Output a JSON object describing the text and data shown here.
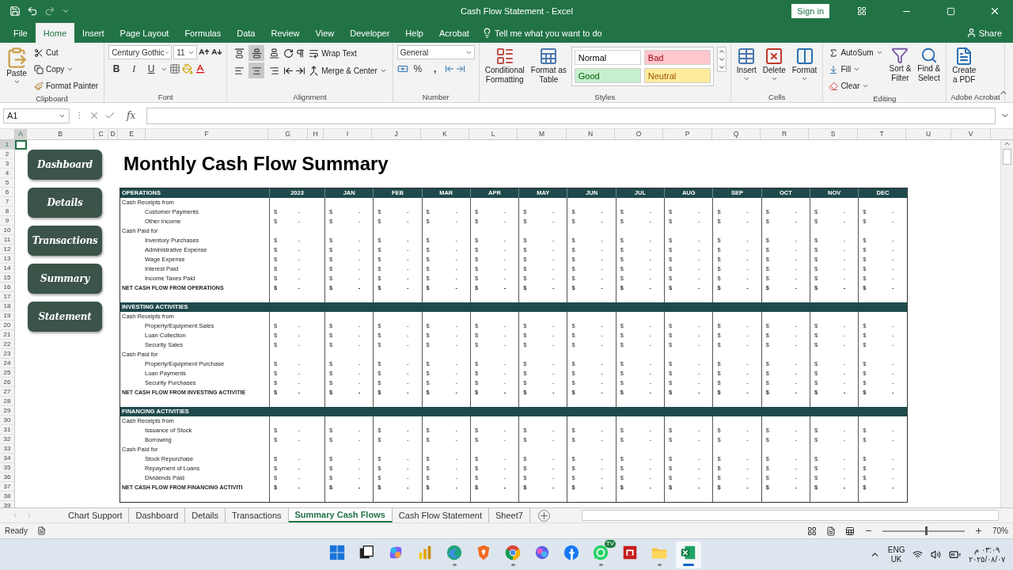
{
  "window": {
    "title": "Cash Flow Statement  -  Excel",
    "sign_in": "Sign in"
  },
  "ribbon_tabs": [
    {
      "label": "File",
      "selected": false
    },
    {
      "label": "Home",
      "selected": true
    },
    {
      "label": "Insert",
      "selected": false
    },
    {
      "label": "Page Layout",
      "selected": false
    },
    {
      "label": "Formulas",
      "selected": false
    },
    {
      "label": "Data",
      "selected": false
    },
    {
      "label": "Review",
      "selected": false
    },
    {
      "label": "View",
      "selected": false
    },
    {
      "label": "Developer",
      "selected": false
    },
    {
      "label": "Help",
      "selected": false
    },
    {
      "label": "Acrobat",
      "selected": false
    }
  ],
  "tell_me": "Tell me what you want to do",
  "share": "Share",
  "ribbon": {
    "clipboard": {
      "paste": "Paste",
      "cut": "Cut",
      "copy": "Copy",
      "format_painter": "Format Painter",
      "label": "Clipboard"
    },
    "font": {
      "name": "Century Gothic",
      "size": "11",
      "bold": "B",
      "italic": "I",
      "underline": "U",
      "label": "Font"
    },
    "alignment": {
      "vertical": [
        {
          "kind": "top",
          "selected": false
        },
        {
          "kind": "middle",
          "selected": true
        },
        {
          "kind": "bottom",
          "selected": false
        }
      ],
      "horizontal": [
        {
          "kind": "left",
          "selected": false
        },
        {
          "kind": "center",
          "selected": true
        },
        {
          "kind": "right",
          "selected": false
        }
      ],
      "wrap_text": "Wrap Text",
      "merge_center": "Merge & Center",
      "label": "Alignment"
    },
    "number": {
      "format": "General",
      "percent": "%",
      "comma": ",",
      "label": "Number"
    },
    "styles": {
      "conditional_formatting": [
        "Conditional",
        "Formatting"
      ],
      "format_as_table": [
        "Format as",
        "Table"
      ],
      "cell_styles": [
        {
          "label": "Normal",
          "kind": "normal",
          "color": "#ffffff"
        },
        {
          "label": "Bad",
          "kind": "bad",
          "color": "#ffc7ce"
        },
        {
          "label": "Good",
          "kind": "good",
          "color": "#c6efce"
        },
        {
          "label": "Neutral",
          "kind": "neutral",
          "color": "#ffeb9c"
        }
      ],
      "label": "Styles"
    },
    "cells": {
      "insert": "Insert",
      "delete": "Delete",
      "format": "Format",
      "label": "Cells"
    },
    "editing": {
      "autosum": "AutoSum",
      "fill": "Fill",
      "clear": "Clear",
      "sort_filter": [
        "Sort &",
        "Filter"
      ],
      "find_select": [
        "Find &",
        "Select"
      ],
      "label": "Editing"
    },
    "acrobat": {
      "create_pdf": [
        "Create",
        "a PDF"
      ],
      "label": "Adobe Acrobat"
    }
  },
  "formula_bar": {
    "name_box": "A1",
    "function_label": "fx"
  },
  "sheet": {
    "columns": [
      {
        "label": "A",
        "selected": true
      },
      {
        "label": "B",
        "selected": false
      },
      {
        "label": "C",
        "selected": false
      },
      {
        "label": "D",
        "selected": false
      },
      {
        "label": "E",
        "selected": false
      },
      {
        "label": "F",
        "selected": false
      },
      {
        "label": "G",
        "selected": false
      },
      {
        "label": "H",
        "selected": false
      },
      {
        "label": "I",
        "selected": false
      },
      {
        "label": "J",
        "selected": false
      },
      {
        "label": "K",
        "selected": false
      },
      {
        "label": "L",
        "selected": false
      },
      {
        "label": "M",
        "selected": false
      },
      {
        "label": "N",
        "selected": false
      },
      {
        "label": "O",
        "selected": false
      },
      {
        "label": "P",
        "selected": false
      },
      {
        "label": "Q",
        "selected": false
      },
      {
        "label": "R",
        "selected": false
      },
      {
        "label": "S",
        "selected": false
      },
      {
        "label": "T",
        "selected": false
      },
      {
        "label": "U",
        "selected": false
      },
      {
        "label": "V",
        "selected": false
      }
    ],
    "rows": [
      {
        "label": "1",
        "selected": true
      },
      {
        "label": "2",
        "selected": false
      },
      {
        "label": "3",
        "selected": false
      },
      {
        "label": "4",
        "selected": false
      },
      {
        "label": "5",
        "selected": false
      },
      {
        "label": "6",
        "selected": false
      },
      {
        "label": "7",
        "selected": false
      },
      {
        "label": "8",
        "selected": false
      },
      {
        "label": "9",
        "selected": false
      },
      {
        "label": "10",
        "selected": false
      },
      {
        "label": "11",
        "selected": false
      },
      {
        "label": "12",
        "selected": false
      },
      {
        "label": "13",
        "selected": false
      },
      {
        "label": "14",
        "selected": false
      },
      {
        "label": "15",
        "selected": false
      },
      {
        "label": "16",
        "selected": false
      },
      {
        "label": "17",
        "selected": false
      },
      {
        "label": "18",
        "selected": false
      },
      {
        "label": "19",
        "selected": false
      },
      {
        "label": "20",
        "selected": false
      },
      {
        "label": "21",
        "selected": false
      },
      {
        "label": "22",
        "selected": false
      },
      {
        "label": "23",
        "selected": false
      },
      {
        "label": "24",
        "selected": false
      },
      {
        "label": "25",
        "selected": false
      },
      {
        "label": "26",
        "selected": false
      },
      {
        "label": "27",
        "selected": false
      },
      {
        "label": "28",
        "selected": false
      },
      {
        "label": "29",
        "selected": false
      },
      {
        "label": "30",
        "selected": false
      },
      {
        "label": "31",
        "selected": false
      },
      {
        "label": "32",
        "selected": false
      },
      {
        "label": "33",
        "selected": false
      },
      {
        "label": "34",
        "selected": false
      },
      {
        "label": "35",
        "selected": false
      },
      {
        "label": "36",
        "selected": false
      },
      {
        "label": "37",
        "selected": false
      },
      {
        "label": "38",
        "selected": false
      },
      {
        "label": "39",
        "selected": false
      }
    ],
    "nav_buttons": [
      "Dashboard",
      "Details",
      "Transactions",
      "Summary",
      "Statement"
    ],
    "title": "Monthly Cash Flow Summary",
    "sections": [
      {
        "heading": "OPERATIONS",
        "column_labels": [
          "2023",
          "JAN",
          "FEB",
          "MAR",
          "APR",
          "MAY",
          "JUN",
          "JUL",
          "AUG",
          "SEP",
          "OCT",
          "NOV",
          "DEC"
        ],
        "rows": [
          {
            "kind": "group",
            "label": "Cash Receipts from"
          },
          {
            "kind": "item",
            "label": "Customer Payments",
            "cells": [
              [
                "$",
                "-"
              ],
              [
                "$",
                "-"
              ],
              [
                "$",
                "-"
              ],
              [
                "$",
                "-"
              ],
              [
                "$",
                "-"
              ],
              [
                "$",
                "-"
              ],
              [
                "$",
                "-"
              ],
              [
                "$",
                "-"
              ],
              [
                "$",
                "-"
              ],
              [
                "$",
                "-"
              ],
              [
                "$",
                "-"
              ],
              [
                "$",
                "-"
              ],
              [
                "$",
                "-"
              ]
            ]
          },
          {
            "kind": "item",
            "label": "Other Income",
            "cells": [
              [
                "$",
                "-"
              ],
              [
                "$",
                "-"
              ],
              [
                "$",
                "-"
              ],
              [
                "$",
                "-"
              ],
              [
                "$",
                "-"
              ],
              [
                "$",
                "-"
              ],
              [
                "$",
                "-"
              ],
              [
                "$",
                "-"
              ],
              [
                "$",
                "-"
              ],
              [
                "$",
                "-"
              ],
              [
                "$",
                "-"
              ],
              [
                "$",
                "-"
              ],
              [
                "$",
                "-"
              ]
            ]
          },
          {
            "kind": "group",
            "label": "Cash Paid for"
          },
          {
            "kind": "item",
            "label": "Inventory Purchases",
            "cells": [
              [
                "$",
                "-"
              ],
              [
                "$",
                "-"
              ],
              [
                "$",
                "-"
              ],
              [
                "$",
                "-"
              ],
              [
                "$",
                "-"
              ],
              [
                "$",
                "-"
              ],
              [
                "$",
                "-"
              ],
              [
                "$",
                "-"
              ],
              [
                "$",
                "-"
              ],
              [
                "$",
                "-"
              ],
              [
                "$",
                "-"
              ],
              [
                "$",
                "-"
              ],
              [
                "$",
                "-"
              ]
            ]
          },
          {
            "kind": "item",
            "label": "Administrative Expense",
            "cells": [
              [
                "$",
                "-"
              ],
              [
                "$",
                "-"
              ],
              [
                "$",
                "-"
              ],
              [
                "$",
                "-"
              ],
              [
                "$",
                "-"
              ],
              [
                "$",
                "-"
              ],
              [
                "$",
                "-"
              ],
              [
                "$",
                "-"
              ],
              [
                "$",
                "-"
              ],
              [
                "$",
                "-"
              ],
              [
                "$",
                "-"
              ],
              [
                "$",
                "-"
              ],
              [
                "$",
                "-"
              ]
            ]
          },
          {
            "kind": "item",
            "label": "Wage Expense",
            "cells": [
              [
                "$",
                "-"
              ],
              [
                "$",
                "-"
              ],
              [
                "$",
                "-"
              ],
              [
                "$",
                "-"
              ],
              [
                "$",
                "-"
              ],
              [
                "$",
                "-"
              ],
              [
                "$",
                "-"
              ],
              [
                "$",
                "-"
              ],
              [
                "$",
                "-"
              ],
              [
                "$",
                "-"
              ],
              [
                "$",
                "-"
              ],
              [
                "$",
                "-"
              ],
              [
                "$",
                "-"
              ]
            ]
          },
          {
            "kind": "item",
            "label": "Interest Paid",
            "cells": [
              [
                "$",
                "-"
              ],
              [
                "$",
                "-"
              ],
              [
                "$",
                "-"
              ],
              [
                "$",
                "-"
              ],
              [
                "$",
                "-"
              ],
              [
                "$",
                "-"
              ],
              [
                "$",
                "-"
              ],
              [
                "$",
                "-"
              ],
              [
                "$",
                "-"
              ],
              [
                "$",
                "-"
              ],
              [
                "$",
                "-"
              ],
              [
                "$",
                "-"
              ],
              [
                "$",
                "-"
              ]
            ]
          },
          {
            "kind": "item",
            "label": "Income Taxes Paid",
            "cells": [
              [
                "$",
                "-"
              ],
              [
                "$",
                "-"
              ],
              [
                "$",
                "-"
              ],
              [
                "$",
                "-"
              ],
              [
                "$",
                "-"
              ],
              [
                "$",
                "-"
              ],
              [
                "$",
                "-"
              ],
              [
                "$",
                "-"
              ],
              [
                "$",
                "-"
              ],
              [
                "$",
                "-"
              ],
              [
                "$",
                "-"
              ],
              [
                "$",
                "-"
              ],
              [
                "$",
                "-"
              ]
            ]
          },
          {
            "kind": "total",
            "label": "NET CASH FLOW FROM OPERATIONS",
            "cells": [
              [
                "$",
                "-"
              ],
              [
                "$",
                "-"
              ],
              [
                "$",
                "-"
              ],
              [
                "$",
                "-"
              ],
              [
                "$",
                "-"
              ],
              [
                "$",
                "-"
              ],
              [
                "$",
                "-"
              ],
              [
                "$",
                "-"
              ],
              [
                "$",
                "-"
              ],
              [
                "$",
                "-"
              ],
              [
                "$",
                "-"
              ],
              [
                "$",
                "-"
              ],
              [
                "$",
                "-"
              ]
            ]
          }
        ]
      },
      {
        "heading": "INVESTING ACTIVITIES",
        "rows": [
          {
            "kind": "group",
            "label": "Cash Receipts from"
          },
          {
            "kind": "item",
            "label": "Property/Equipment Sales",
            "cells": [
              [
                "$",
                "-"
              ],
              [
                "$",
                "-"
              ],
              [
                "$",
                "-"
              ],
              [
                "$",
                "-"
              ],
              [
                "$",
                "-"
              ],
              [
                "$",
                "-"
              ],
              [
                "$",
                "-"
              ],
              [
                "$",
                "-"
              ],
              [
                "$",
                "-"
              ],
              [
                "$",
                "-"
              ],
              [
                "$",
                "-"
              ],
              [
                "$",
                "-"
              ],
              [
                "$",
                "-"
              ]
            ]
          },
          {
            "kind": "item",
            "label": "Loan Collection",
            "cells": [
              [
                "$",
                "-"
              ],
              [
                "$",
                "-"
              ],
              [
                "$",
                "-"
              ],
              [
                "$",
                "-"
              ],
              [
                "$",
                "-"
              ],
              [
                "$",
                "-"
              ],
              [
                "$",
                "-"
              ],
              [
                "$",
                "-"
              ],
              [
                "$",
                "-"
              ],
              [
                "$",
                "-"
              ],
              [
                "$",
                "-"
              ],
              [
                "$",
                "-"
              ],
              [
                "$",
                "-"
              ]
            ]
          },
          {
            "kind": "item",
            "label": "Security Sales",
            "cells": [
              [
                "$",
                "-"
              ],
              [
                "$",
                "-"
              ],
              [
                "$",
                "-"
              ],
              [
                "$",
                "-"
              ],
              [
                "$",
                "-"
              ],
              [
                "$",
                "-"
              ],
              [
                "$",
                "-"
              ],
              [
                "$",
                "-"
              ],
              [
                "$",
                "-"
              ],
              [
                "$",
                "-"
              ],
              [
                "$",
                "-"
              ],
              [
                "$",
                "-"
              ],
              [
                "$",
                "-"
              ]
            ]
          },
          {
            "kind": "group",
            "label": "Cash Paid for"
          },
          {
            "kind": "item",
            "label": "Property/Equipment Purchase",
            "cells": [
              [
                "$",
                "-"
              ],
              [
                "$",
                "-"
              ],
              [
                "$",
                "-"
              ],
              [
                "$",
                "-"
              ],
              [
                "$",
                "-"
              ],
              [
                "$",
                "-"
              ],
              [
                "$",
                "-"
              ],
              [
                "$",
                "-"
              ],
              [
                "$",
                "-"
              ],
              [
                "$",
                "-"
              ],
              [
                "$",
                "-"
              ],
              [
                "$",
                "-"
              ],
              [
                "$",
                "-"
              ]
            ]
          },
          {
            "kind": "item",
            "label": "Loan Payments",
            "cells": [
              [
                "$",
                "-"
              ],
              [
                "$",
                "-"
              ],
              [
                "$",
                "-"
              ],
              [
                "$",
                "-"
              ],
              [
                "$",
                "-"
              ],
              [
                "$",
                "-"
              ],
              [
                "$",
                "-"
              ],
              [
                "$",
                "-"
              ],
              [
                "$",
                "-"
              ],
              [
                "$",
                "-"
              ],
              [
                "$",
                "-"
              ],
              [
                "$",
                "-"
              ],
              [
                "$",
                "-"
              ]
            ]
          },
          {
            "kind": "item",
            "label": "Security Purchases",
            "cells": [
              [
                "$",
                "-"
              ],
              [
                "$",
                "-"
              ],
              [
                "$",
                "-"
              ],
              [
                "$",
                "-"
              ],
              [
                "$",
                "-"
              ],
              [
                "$",
                "-"
              ],
              [
                "$",
                "-"
              ],
              [
                "$",
                "-"
              ],
              [
                "$",
                "-"
              ],
              [
                "$",
                "-"
              ],
              [
                "$",
                "-"
              ],
              [
                "$",
                "-"
              ],
              [
                "$",
                "-"
              ]
            ]
          },
          {
            "kind": "total",
            "label": "NET CASH FLOW FROM INVESTING ACTIVITIE",
            "cells": [
              [
                "$",
                "-"
              ],
              [
                "$",
                "-"
              ],
              [
                "$",
                "-"
              ],
              [
                "$",
                "-"
              ],
              [
                "$",
                "-"
              ],
              [
                "$",
                "-"
              ],
              [
                "$",
                "-"
              ],
              [
                "$",
                "-"
              ],
              [
                "$",
                "-"
              ],
              [
                "$",
                "-"
              ],
              [
                "$",
                "-"
              ],
              [
                "$",
                "-"
              ],
              [
                "$",
                "-"
              ]
            ]
          }
        ]
      },
      {
        "heading": "FINANCING ACTIVITIES",
        "rows": [
          {
            "kind": "group",
            "label": "Cash Receipts from"
          },
          {
            "kind": "item",
            "label": "Issuance of Stock",
            "cells": [
              [
                "$",
                "-"
              ],
              [
                "$",
                "-"
              ],
              [
                "$",
                "-"
              ],
              [
                "$",
                "-"
              ],
              [
                "$",
                "-"
              ],
              [
                "$",
                "-"
              ],
              [
                "$",
                "-"
              ],
              [
                "$",
                "-"
              ],
              [
                "$",
                "-"
              ],
              [
                "$",
                "-"
              ],
              [
                "$",
                "-"
              ],
              [
                "$",
                "-"
              ],
              [
                "$",
                "-"
              ]
            ]
          },
          {
            "kind": "item",
            "label": "Borrowing",
            "cells": [
              [
                "$",
                "-"
              ],
              [
                "$",
                "-"
              ],
              [
                "$",
                "-"
              ],
              [
                "$",
                "-"
              ],
              [
                "$",
                "-"
              ],
              [
                "$",
                "-"
              ],
              [
                "$",
                "-"
              ],
              [
                "$",
                "-"
              ],
              [
                "$",
                "-"
              ],
              [
                "$",
                "-"
              ],
              [
                "$",
                "-"
              ],
              [
                "$",
                "-"
              ],
              [
                "$",
                "-"
              ]
            ]
          },
          {
            "kind": "group",
            "label": "Cash Paid for"
          },
          {
            "kind": "item",
            "label": "Stock Repurchase",
            "cells": [
              [
                "$",
                "-"
              ],
              [
                "$",
                "-"
              ],
              [
                "$",
                "-"
              ],
              [
                "$",
                "-"
              ],
              [
                "$",
                "-"
              ],
              [
                "$",
                "-"
              ],
              [
                "$",
                "-"
              ],
              [
                "$",
                "-"
              ],
              [
                "$",
                "-"
              ],
              [
                "$",
                "-"
              ],
              [
                "$",
                "-"
              ],
              [
                "$",
                "-"
              ],
              [
                "$",
                "-"
              ]
            ]
          },
          {
            "kind": "item",
            "label": "Repayment of Loans",
            "cells": [
              [
                "$",
                "-"
              ],
              [
                "$",
                "-"
              ],
              [
                "$",
                "-"
              ],
              [
                "$",
                "-"
              ],
              [
                "$",
                "-"
              ],
              [
                "$",
                "-"
              ],
              [
                "$",
                "-"
              ],
              [
                "$",
                "-"
              ],
              [
                "$",
                "-"
              ],
              [
                "$",
                "-"
              ],
              [
                "$",
                "-"
              ],
              [
                "$",
                "-"
              ],
              [
                "$",
                "-"
              ]
            ]
          },
          {
            "kind": "item",
            "label": "Dividends Paid",
            "cells": [
              [
                "$",
                "-"
              ],
              [
                "$",
                "-"
              ],
              [
                "$",
                "-"
              ],
              [
                "$",
                "-"
              ],
              [
                "$",
                "-"
              ],
              [
                "$",
                "-"
              ],
              [
                "$",
                "-"
              ],
              [
                "$",
                "-"
              ],
              [
                "$",
                "-"
              ],
              [
                "$",
                "-"
              ],
              [
                "$",
                "-"
              ],
              [
                "$",
                "-"
              ],
              [
                "$",
                "-"
              ]
            ]
          },
          {
            "kind": "total",
            "label": "NET CASH FLOW FROM FINANCING ACTIVITI",
            "cells": [
              [
                "$",
                "-"
              ],
              [
                "$",
                "-"
              ],
              [
                "$",
                "-"
              ],
              [
                "$",
                "-"
              ],
              [
                "$",
                "-"
              ],
              [
                "$",
                "-"
              ],
              [
                "$",
                "-"
              ],
              [
                "$",
                "-"
              ],
              [
                "$",
                "-"
              ],
              [
                "$",
                "-"
              ],
              [
                "$",
                "-"
              ],
              [
                "$",
                "-"
              ],
              [
                "$",
                "-"
              ]
            ]
          }
        ]
      }
    ]
  },
  "sheet_tabs": [
    {
      "label": "Chart Support",
      "selected": false
    },
    {
      "label": "Dashboard",
      "selected": false
    },
    {
      "label": "Details",
      "selected": false
    },
    {
      "label": "Transactions",
      "selected": false
    },
    {
      "label": "Summary Cash Flows",
      "selected": true
    },
    {
      "label": "Cash Flow Statement",
      "selected": false
    },
    {
      "label": "Sheet7",
      "selected": false
    }
  ],
  "status_bar": {
    "status": "Ready",
    "zoom": "70%",
    "zoom_slider": {
      "level": 0.52
    }
  },
  "taskbar": {
    "apps": [
      {
        "kind": "start",
        "running": false,
        "selected": false
      },
      {
        "kind": "taskview",
        "running": false,
        "selected": false
      },
      {
        "kind": "copilot",
        "running": false,
        "selected": false
      },
      {
        "kind": "chart",
        "running": false,
        "selected": false
      },
      {
        "kind": "edge",
        "running": true,
        "selected": false
      },
      {
        "kind": "brave",
        "running": false,
        "selected": false
      },
      {
        "kind": "chrome",
        "running": true,
        "selected": false
      },
      {
        "kind": "sparkle",
        "running": false,
        "selected": false
      },
      {
        "kind": "facebook",
        "running": false,
        "selected": false
      },
      {
        "kind": "whatsapp",
        "running": true,
        "selected": false,
        "badge": "TV"
      },
      {
        "kind": "mail",
        "running": false,
        "selected": false
      },
      {
        "kind": "folder",
        "running": true,
        "selected": false
      },
      {
        "kind": "excel",
        "running": true,
        "selected": true
      }
    ],
    "language": [
      "ENG",
      "UK"
    ],
    "time": "٠٣:٠٩ م",
    "date": "٢٠٢٥/٠٨/٠٧"
  }
}
